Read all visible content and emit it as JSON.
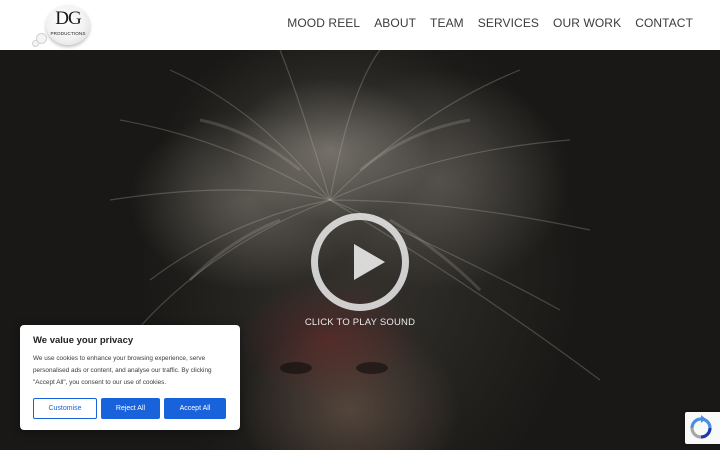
{
  "header": {
    "logo": {
      "mark_text": "DG",
      "sub_text": "PRODUCTIONS"
    },
    "nav": [
      {
        "label": "MOOD REEL"
      },
      {
        "label": "ABOUT"
      },
      {
        "label": "TEAM"
      },
      {
        "label": "SERVICES"
      },
      {
        "label": "OUR WORK"
      },
      {
        "label": "CONTACT"
      }
    ]
  },
  "hero": {
    "play_icon": "play-circle-icon",
    "play_label": "CLICK TO PLAY SOUND"
  },
  "cookie_banner": {
    "title": "We value your privacy",
    "body": "We use cookies to enhance your browsing experience, serve personalised ads or content, and analyse our traffic. By clicking \"Accept All\", you consent to our use of cookies.",
    "buttons": {
      "customise": "Customise",
      "reject": "Reject All",
      "accept": "Accept All"
    },
    "accent_color": "#1863dc"
  },
  "recaptcha": {
    "icon": "recaptcha-icon"
  }
}
